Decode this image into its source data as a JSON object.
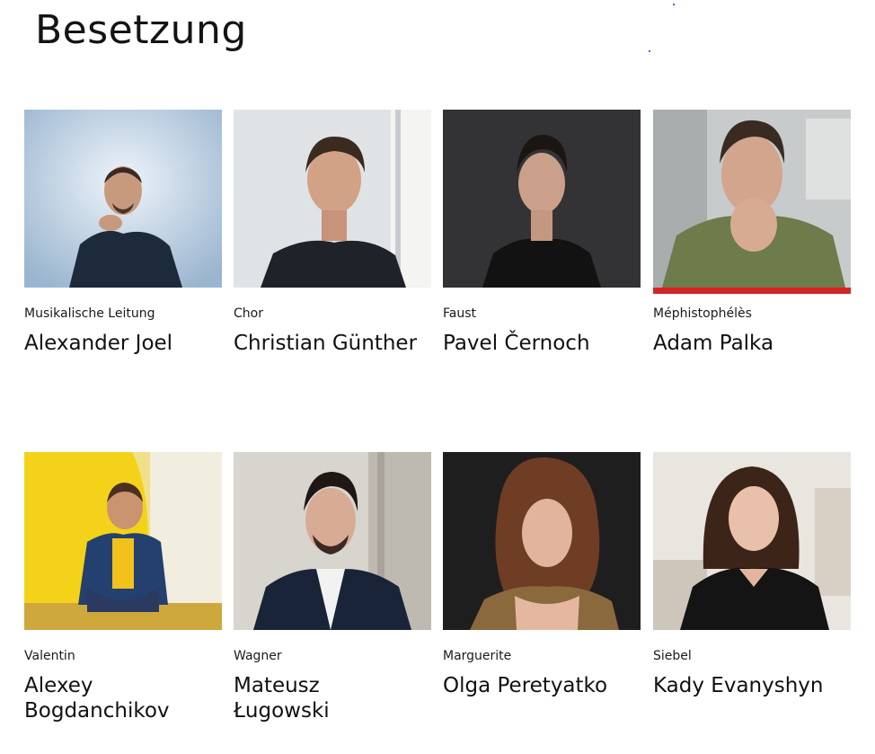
{
  "page": {
    "title": "Besetzung"
  },
  "cast": [
    {
      "role": "Musikalische Leitung",
      "name": "Alexander Joel"
    },
    {
      "role": "Chor",
      "name": "Christian Günther"
    },
    {
      "role": "Faust",
      "name": "Pavel Černoch"
    },
    {
      "role": "Méphistophélès",
      "name": "Adam Palka"
    },
    {
      "role": "Valentin",
      "name": "Alexey Bogdanchikov"
    },
    {
      "role": "Wagner",
      "name": "Mateusz Ługowski"
    },
    {
      "role": "Marguerite",
      "name": "Olga Peretyatko"
    },
    {
      "role": "Siebel",
      "name": "Kady Evanyshyn"
    }
  ],
  "colors": {
    "accent": "#d62424",
    "text": "#111111",
    "background": "#ffffff"
  }
}
